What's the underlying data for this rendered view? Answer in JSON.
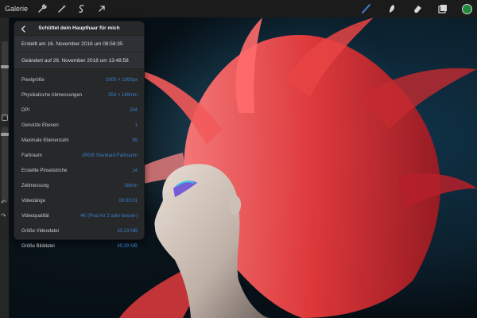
{
  "topbar": {
    "gallery_label": "Galerie",
    "left_icons": [
      "wrench-icon",
      "magic-wand-icon",
      "selection-icon",
      "transform-arrow-icon"
    ],
    "right_icons": [
      "brush-icon",
      "smudge-icon",
      "eraser-icon",
      "layers-icon"
    ],
    "current_color": "#1d8a3b"
  },
  "popover": {
    "title": "Schüttel dein Hauptha­ar für mich",
    "created": "Erstellt am 16. November 2018 um 08:56:35",
    "modified": "Geändert auf 26. November 2018 um 13:48:58",
    "rows": [
      {
        "label": "Pixelgröße",
        "value": "3000 × 1993px"
      },
      {
        "label": "Physikalische Abmessungen",
        "value": "254 × 169mm"
      },
      {
        "label": "DPI",
        "value": "264"
      },
      {
        "label": "Genutzte Ebenen",
        "value": "1"
      },
      {
        "label": "Maximale Ebenenzahl",
        "value": "85"
      },
      {
        "label": "Farbraum",
        "value": "sRGB Standard-Farbraum"
      },
      {
        "label": "Erstellte Pinselstriche",
        "value": "14"
      },
      {
        "label": "Zeitmessung",
        "value": "58min"
      },
      {
        "label": "Videolänge",
        "value": "00:00:01"
      },
      {
        "label": "Videoqualität",
        "value": "4K (iPad Air 2 oder besser)"
      },
      {
        "label": "Größe Videodatei",
        "value": "33,23 MB"
      },
      {
        "label": "Größe Bilddatei",
        "value": "49,39 MB"
      }
    ]
  },
  "colors": {
    "accent_value": "#3c7ec8",
    "panel_bg": "#26282a",
    "toolbar_bg": "#1b1b1b",
    "active_tool": "#3b82d6"
  }
}
